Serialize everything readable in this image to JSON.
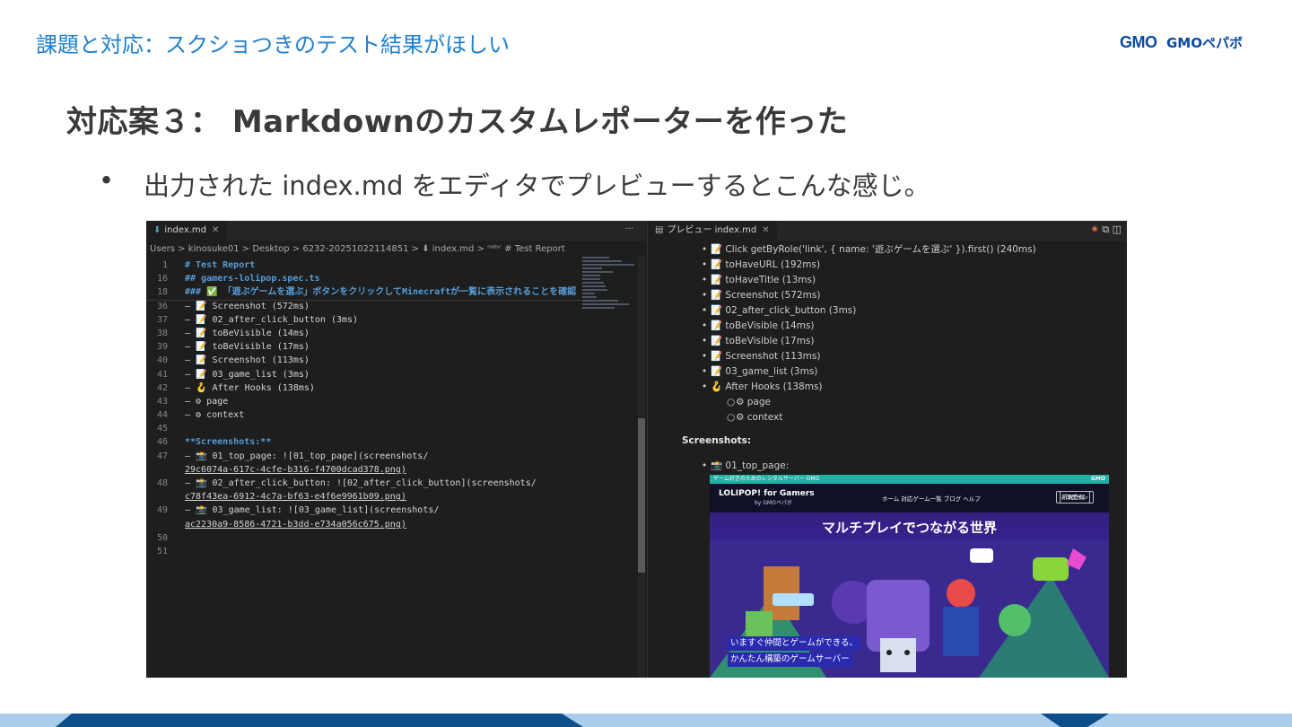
{
  "header": {
    "title": "課題と対応：スクショつきのテスト結果がほしい",
    "logo_text": "GMOペパボ"
  },
  "slide": {
    "title": "対応案３： Markdownのカスタムレポーターを作った",
    "bullet_symbol": "•",
    "bullet": "出力された index.md をエディタでプレビューするとこんな感じ。"
  },
  "editor": {
    "tab_label": "index.md",
    "tab_more": "···",
    "breadcrumb": "Users > kinosuke01 > Desktop > 6232-20251022114851 > ⬇ index.md > ⁿᵃᵇᶜ # Test Report",
    "lines": [
      {
        "num": "1",
        "text": "# Test Report",
        "style": "head"
      },
      {
        "num": "16",
        "text": "## gamers-lolipop.spec.ts",
        "style": "head"
      },
      {
        "num": "18",
        "text": "### ✅ 「遊ぶゲームを選ぶ」ボタンをクリックしてMinecraftが一覧に表示されることを確認",
        "style": "head"
      },
      {
        "num": "36",
        "text": "– 📝 Screenshot (572ms)",
        "style": "plain"
      },
      {
        "num": "37",
        "text": "– 📝 02_after_click_button (3ms)",
        "style": "plain"
      },
      {
        "num": "38",
        "text": "– 📝 toBeVisible (14ms)",
        "style": "plain"
      },
      {
        "num": "39",
        "text": "– 📝 toBeVisible (17ms)",
        "style": "plain"
      },
      {
        "num": "40",
        "text": "– 📝 Screenshot (113ms)",
        "style": "plain"
      },
      {
        "num": "41",
        "text": "– 📝 03_game_list (3ms)",
        "style": "plain"
      },
      {
        "num": "42",
        "text": "– 🪝 After Hooks (138ms)",
        "style": "plain"
      },
      {
        "num": "43",
        "text": "  – ⚙ page",
        "style": "plain"
      },
      {
        "num": "44",
        "text": "  – ⚙ context",
        "style": "plain"
      },
      {
        "num": "45",
        "text": "",
        "style": "plain"
      },
      {
        "num": "46",
        "text": "**Screenshots:**",
        "style": "bold"
      },
      {
        "num": "47",
        "text": "– 📸 01_top_page: ![01_top_page](screenshots/",
        "style": "plain"
      },
      {
        "num": "",
        "text": "29c6074a-617c-4cfe-b316-f4700dcad378.png)",
        "style": "url"
      },
      {
        "num": "48",
        "text": "– 📸 02_after_click_button: ![02_after_click_button](screenshots/",
        "style": "plain"
      },
      {
        "num": "",
        "text": "c78f43ea-6912-4c7a-bf63-e4f6e9961b09.png)",
        "style": "url"
      },
      {
        "num": "49",
        "text": "– 📸 03_game_list: ![03_game_list](screenshots/",
        "style": "plain"
      },
      {
        "num": "",
        "text": "ac2230a9-8586-4721-b3dd-e734a056c675.png)",
        "style": "url"
      },
      {
        "num": "50",
        "text": "",
        "style": "plain"
      },
      {
        "num": "51",
        "text": "",
        "style": "plain"
      }
    ]
  },
  "preview": {
    "tab_label": "プレビュー index.md",
    "items": [
      "📝 Click getByRole('link', { name: '遊ぶゲームを選ぶ' }).first() (240ms)",
      "📝 toHaveURL (192ms)",
      "📝 toHaveTitle (13ms)",
      "📝 Screenshot (572ms)",
      "📝 02_after_click_button (3ms)",
      "📝 toBeVisible (14ms)",
      "📝 toBeVisible (17ms)",
      "📝 Screenshot (113ms)",
      "📝 03_game_list (3ms)",
      "🪝 After Hooks (138ms)"
    ],
    "sub_items": [
      "⚙ page",
      "⚙ context"
    ],
    "bullet": "•",
    "sub_bullet": "○",
    "screenshots_heading": "Screenshots:",
    "shot_item": "📸 01_top_page:",
    "site": {
      "topbar_text": "ゲーム好きのためのレンタルサーバー GMO",
      "topbar_gmo": "GMO",
      "brand": "LOLIPOP! for Gamers",
      "brand_sub": "by GMOペパボ",
      "nav_links": "ホーム   対応ゲーム一覧   ブログ   ヘルプ",
      "signup": "新規登録",
      "login": "ログイン",
      "hero": "マルチプレイでつながる世界",
      "tagline_1": "いますぐ仲間とゲームができる、",
      "tagline_2": "かんたん構築のゲームサーバー"
    }
  },
  "colors": {
    "accent_blue": "#1f7fd0",
    "footer_light": "#a9cdea",
    "footer_dark": "#0c4f8a"
  }
}
